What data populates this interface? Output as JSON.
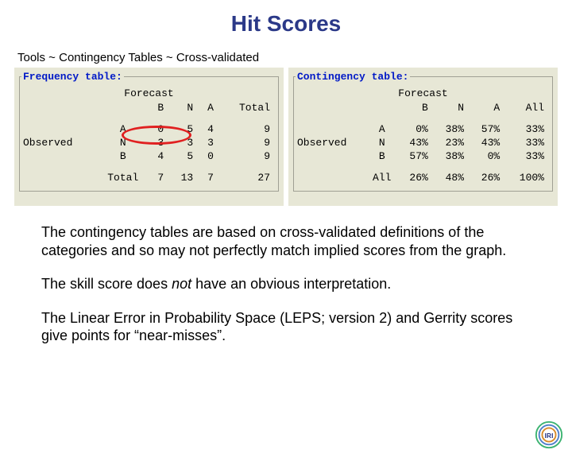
{
  "title": "Hit Scores",
  "breadcrumb": "Tools ~ Contingency Tables ~ Cross-validated",
  "freq": {
    "label": "Frequency table:",
    "col_title": "Forecast",
    "observed_label": "Observed",
    "cols": [
      "B",
      "N",
      "A",
      "Total"
    ],
    "rows": [
      {
        "label": "A",
        "v": [
          "0",
          "5",
          "4",
          "9"
        ]
      },
      {
        "label": "N",
        "v": [
          "3",
          "3",
          "3",
          "9"
        ]
      },
      {
        "label": "B",
        "v": [
          "4",
          "5",
          "0",
          "9"
        ]
      }
    ],
    "total_row": {
      "label": "Total",
      "v": [
        "7",
        "13",
        "7",
        "27"
      ]
    }
  },
  "cont": {
    "label": "Contingency table:",
    "col_title": "Forecast",
    "observed_label": "Observed",
    "cols": [
      "B",
      "N",
      "A",
      "All"
    ],
    "rows": [
      {
        "label": "A",
        "v": [
          "0%",
          "38%",
          "57%",
          "33%"
        ]
      },
      {
        "label": "N",
        "v": [
          "43%",
          "23%",
          "43%",
          "33%"
        ]
      },
      {
        "label": "B",
        "v": [
          "57%",
          "38%",
          "0%",
          "33%"
        ]
      }
    ],
    "total_row": {
      "label": "All",
      "v": [
        "26%",
        "48%",
        "26%",
        "100%"
      ]
    }
  },
  "paragraphs": {
    "p1": "The contingency tables are based on cross-validated definitions of the categories and so may not perfectly match implied scores from the graph.",
    "p2a": "The skill score does ",
    "p2_not": "not",
    "p2b": " have an obvious interpretation.",
    "p3": "The Linear Error in Probability Space (LEPS; version 2) and Gerrity scores give points for “near-misses”."
  },
  "logo_text": "IRI",
  "chart_data": [
    {
      "type": "table",
      "title": "Frequency table: Forecast vs Observed",
      "categories": [
        "B",
        "N",
        "A",
        "Total"
      ],
      "series": [
        {
          "name": "Observed A",
          "values": [
            0,
            5,
            4,
            9
          ]
        },
        {
          "name": "Observed N",
          "values": [
            3,
            3,
            3,
            9
          ]
        },
        {
          "name": "Observed B",
          "values": [
            4,
            5,
            0,
            9
          ]
        },
        {
          "name": "Total",
          "values": [
            7,
            13,
            7,
            27
          ]
        }
      ],
      "highlight": {
        "row": "Observed A",
        "cols": [
          "N",
          "A"
        ],
        "note": "near-miss cells circled in red"
      }
    },
    {
      "type": "table",
      "title": "Contingency table: Forecast vs Observed (%)",
      "categories": [
        "B",
        "N",
        "A",
        "All"
      ],
      "series": [
        {
          "name": "Observed A",
          "values": [
            0,
            38,
            57,
            33
          ]
        },
        {
          "name": "Observed N",
          "values": [
            43,
            23,
            43,
            33
          ]
        },
        {
          "name": "Observed B",
          "values": [
            57,
            38,
            0,
            33
          ]
        },
        {
          "name": "All",
          "values": [
            26,
            48,
            26,
            100
          ]
        }
      ]
    }
  ]
}
